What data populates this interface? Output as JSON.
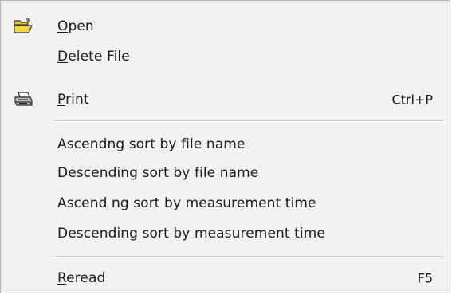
{
  "menu": {
    "open": {
      "mnemonic": "O",
      "rest": "pen",
      "icon": "open-folder-icon"
    },
    "delete_file": {
      "mnemonic": "D",
      "rest": "elete File"
    },
    "print": {
      "mnemonic": "P",
      "rest": "rint",
      "shortcut": "Ctrl+P",
      "icon": "printer-icon"
    },
    "sort_asc_name": {
      "label": "Ascendng sort by file name"
    },
    "sort_desc_name": {
      "label": "Descending sort by file name"
    },
    "sort_asc_time": {
      "label": "Ascend ng sort by measurement timе"
    },
    "sort_desc_time": {
      "label": "Descending sort by measurement time"
    },
    "reread": {
      "mnemonic": "R",
      "rest": "eread",
      "shortcut": "F5"
    }
  },
  "colors": {
    "menu_background": "#f2f2f2",
    "text": "#1a1a1a",
    "separator": "#c9c9c9",
    "folder_yellow": "#f5d742"
  }
}
